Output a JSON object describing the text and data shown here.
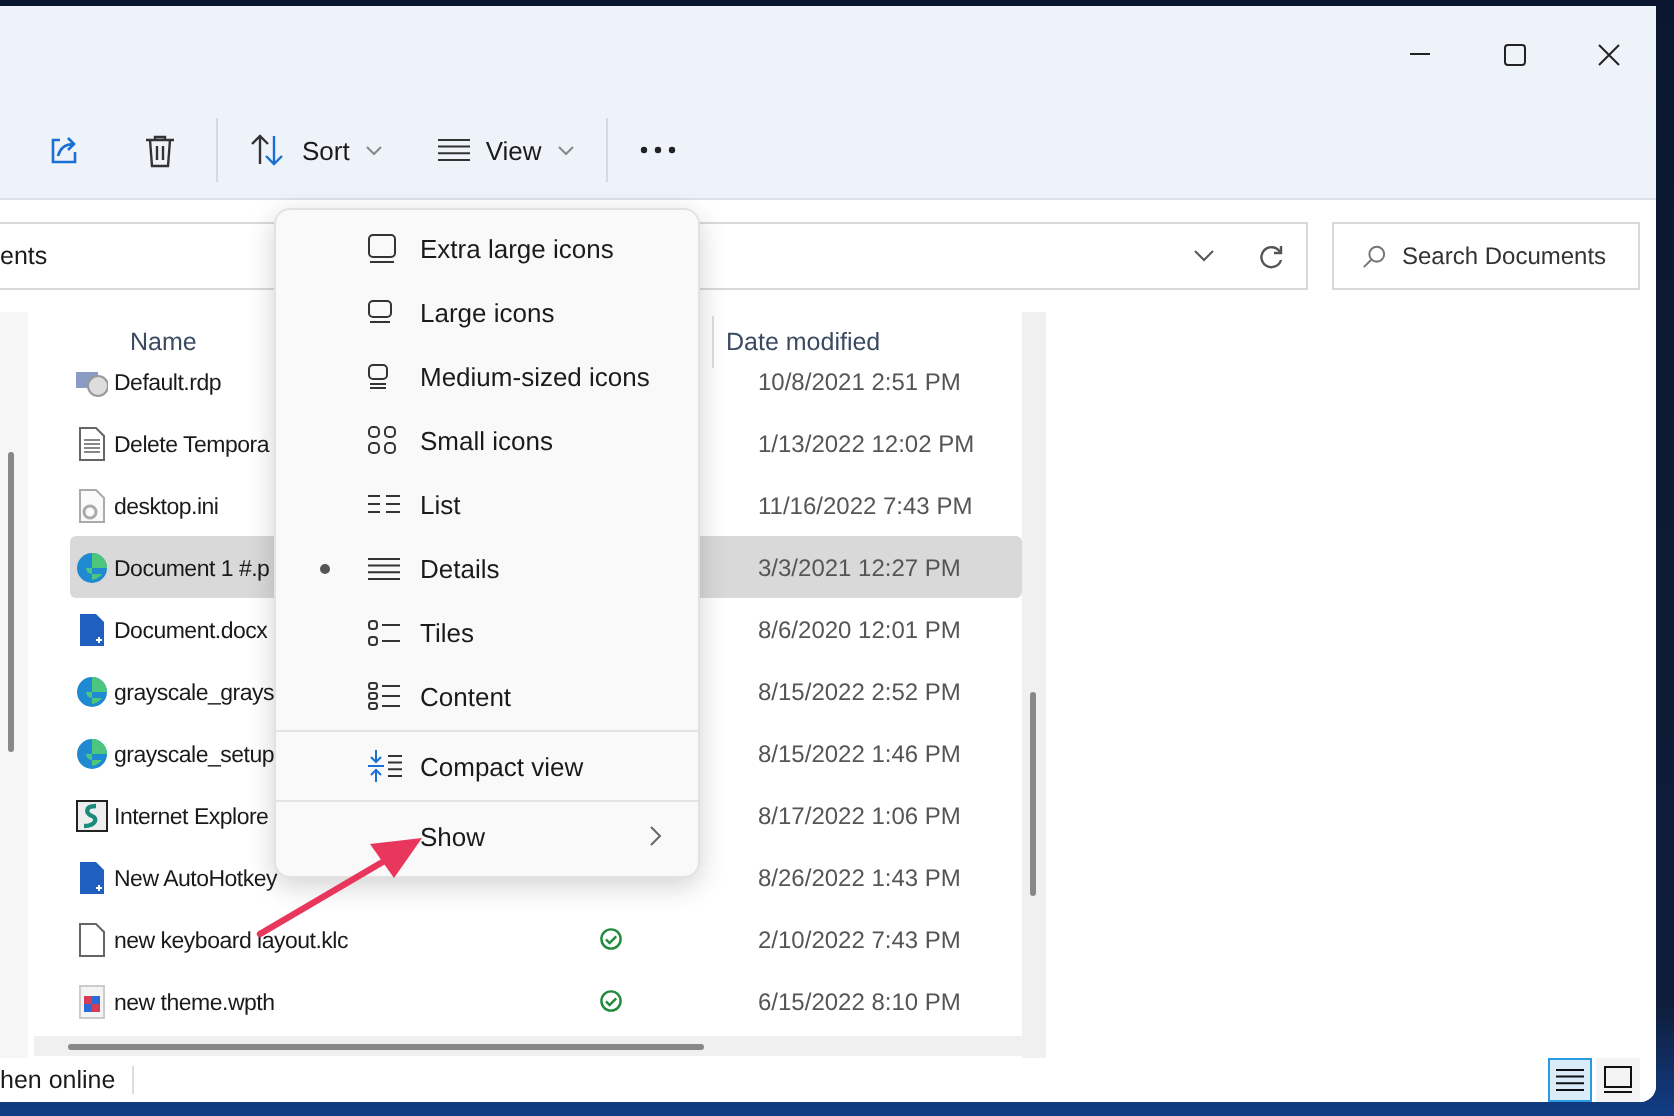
{
  "toolbar": {
    "sort": "Sort",
    "view": "View"
  },
  "address": {
    "value": "ents",
    "search_placeholder": "Search Documents"
  },
  "columns": {
    "name": "Name",
    "date": "Date modified"
  },
  "rows": [
    {
      "name": "Default.rdp",
      "kind": "rdp",
      "date": "10/8/2021 2:51 PM",
      "selected": false,
      "synced": false
    },
    {
      "name": "Delete Tempora",
      "kind": "text",
      "date": "1/13/2022 12:02 PM",
      "selected": false,
      "synced": false
    },
    {
      "name": "desktop.ini",
      "kind": "settings",
      "date": "11/16/2022 7:43 PM",
      "selected": false,
      "synced": false
    },
    {
      "name": "Document 1 #.p",
      "kind": "edge",
      "date": "3/3/2021 12:27 PM",
      "selected": true,
      "synced": false
    },
    {
      "name": "Document.docx",
      "kind": "doc",
      "date": "8/6/2020 12:01 PM",
      "selected": false,
      "synced": false
    },
    {
      "name": "grayscale_grays",
      "kind": "edge",
      "date": "8/15/2022 2:52 PM",
      "selected": false,
      "synced": false
    },
    {
      "name": "grayscale_setup",
      "kind": "edge",
      "date": "8/15/2022 1:46 PM",
      "selected": false,
      "synced": false
    },
    {
      "name": "Internet Explore",
      "kind": "app",
      "date": "8/17/2022 1:06 PM",
      "selected": false,
      "synced": false
    },
    {
      "name": "New AutoHotkey",
      "kind": "doc",
      "date": "8/26/2022 1:43 PM",
      "selected": false,
      "synced": false
    },
    {
      "name": "new keyboard layout.klc",
      "kind": "blank",
      "date": "2/10/2022 7:43 PM",
      "selected": false,
      "synced": true
    },
    {
      "name": "new theme.wpth",
      "kind": "theme",
      "date": "6/15/2022 8:10 PM",
      "selected": false,
      "synced": true
    }
  ],
  "view_menu": {
    "groups": [
      [
        {
          "label": "Extra large icons",
          "kind": "xl",
          "selected": false
        },
        {
          "label": "Large icons",
          "kind": "large",
          "selected": false
        },
        {
          "label": "Medium-sized icons",
          "kind": "medium",
          "selected": false
        },
        {
          "label": "Small icons",
          "kind": "small",
          "selected": false
        },
        {
          "label": "List",
          "kind": "list",
          "selected": false
        },
        {
          "label": "Details",
          "kind": "details",
          "selected": true
        },
        {
          "label": "Tiles",
          "kind": "tiles",
          "selected": false
        },
        {
          "label": "Content",
          "kind": "content",
          "selected": false
        }
      ],
      [
        {
          "label": "Compact view",
          "kind": "compact",
          "selected": false
        }
      ],
      [
        {
          "label": "Show",
          "kind": "submenu",
          "selected": false
        }
      ]
    ]
  },
  "status_bar": {
    "text": "hen online",
    "layouts": [
      {
        "kind": "details",
        "selected": true
      },
      {
        "kind": "large",
        "selected": false
      }
    ]
  }
}
